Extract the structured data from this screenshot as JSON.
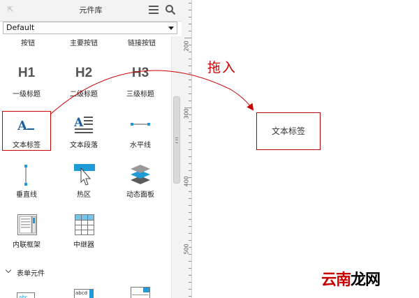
{
  "library": {
    "title": "元件库",
    "selector": "Default",
    "top_row_partial": [
      "按钮",
      "主要按钮",
      "链接按钮"
    ],
    "headings": [
      {
        "glyph": "H1",
        "label": "一级标题"
      },
      {
        "glyph": "H2",
        "label": "二级标题"
      },
      {
        "glyph": "H3",
        "label": "三级标题"
      }
    ],
    "row3": [
      {
        "label": "文本标签",
        "icon": "text-label-icon"
      },
      {
        "label": "文本段落",
        "icon": "text-paragraph-icon"
      },
      {
        "label": "水平线",
        "icon": "horizontal-line-icon"
      }
    ],
    "row4": [
      {
        "label": "垂直线",
        "icon": "vertical-line-icon"
      },
      {
        "label": "热区",
        "icon": "hotspot-icon"
      },
      {
        "label": "动态面板",
        "icon": "dynamic-panel-icon"
      }
    ],
    "row5": [
      {
        "label": "内联框架",
        "icon": "inline-frame-icon"
      },
      {
        "label": "中继器",
        "icon": "repeater-icon"
      }
    ],
    "section": "表单元件"
  },
  "ruler": [
    "200",
    "300",
    "400",
    "500"
  ],
  "canvas": {
    "drag_hint": "拖入",
    "dropped_widget": "文本标签"
  },
  "watermark": {
    "red": "云南",
    "black": "龙网"
  },
  "colors": {
    "accent_red": "#cc0000",
    "icon_blue": "#1f9bd8",
    "heading_gray": "#555555"
  }
}
